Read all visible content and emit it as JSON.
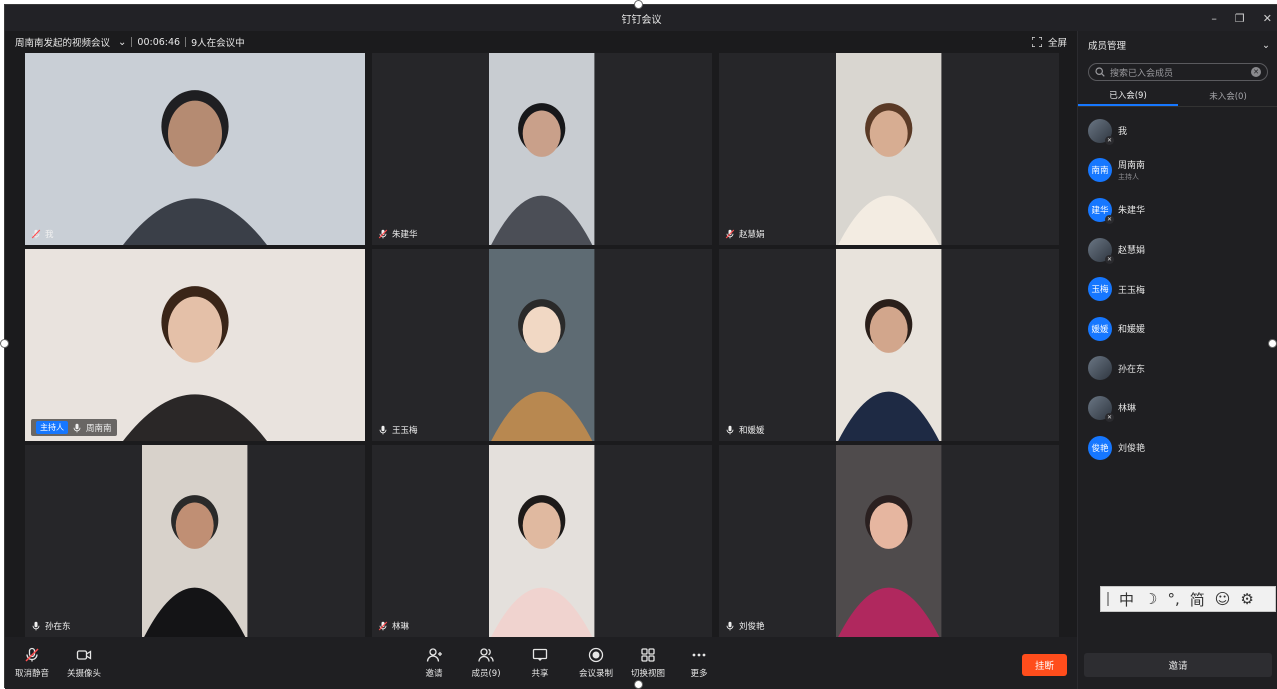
{
  "window": {
    "title": "钉钉会议",
    "controls": [
      "–",
      "❐",
      "✕"
    ]
  },
  "infobar": {
    "meeting_name": "周南南发起的视频会议",
    "duration": "00:06:46",
    "count_text": "9人在会议中",
    "fullscreen_label": "全屏"
  },
  "tiles": [
    {
      "name": "我",
      "mic": "muted",
      "host": false,
      "active": false,
      "bg": "#c9cfd6",
      "shirt": "#3a3f48",
      "skin": "#b58b72",
      "hair": "#1f1f22",
      "video_width_pct": 100
    },
    {
      "name": "朱建华",
      "mic": "muted",
      "host": false,
      "active": false,
      "bg": "#c8ccd1",
      "shirt": "#4b4e56",
      "skin": "#c9a08a",
      "hair": "#17171a",
      "video_width_pct": 31
    },
    {
      "name": "赵慧娟",
      "mic": "muted",
      "host": false,
      "active": false,
      "bg": "#d9d6d0",
      "shirt": "#f3ece2",
      "skin": "#d7ad92",
      "hair": "#5a3a26",
      "video_width_pct": 31
    },
    {
      "name": "周南南",
      "mic": "on",
      "host": true,
      "host_label": "主持人",
      "active": true,
      "bg": "#e9e3de",
      "shirt": "#2a2727",
      "skin": "#e4c0a8",
      "hair": "#3a2518",
      "video_width_pct": 100
    },
    {
      "name": "王玉梅",
      "mic": "on",
      "host": false,
      "active": false,
      "bg": "#5e6b73",
      "shirt": "#b88850",
      "skin": "#f1d8c4",
      "hair": "#2a2a2a",
      "video_width_pct": 31
    },
    {
      "name": "和媛媛",
      "mic": "on",
      "host": false,
      "active": false,
      "bg": "#e8e3dc",
      "shirt": "#1e2a44",
      "skin": "#d2a68c",
      "hair": "#2a1f1a",
      "video_width_pct": 31
    },
    {
      "name": "孙在东",
      "mic": "on",
      "host": false,
      "active": false,
      "bg": "#d8d2cb",
      "shirt": "#141416",
      "skin": "#c08f74",
      "hair": "#2a2a2a",
      "video_width_pct": 31
    },
    {
      "name": "林琳",
      "mic": "muted",
      "host": false,
      "active": false,
      "bg": "#e4e0dc",
      "shirt": "#f0d3cf",
      "skin": "#e0b9a0",
      "hair": "#1d1a19",
      "video_width_pct": 31
    },
    {
      "name": "刘俊艳",
      "mic": "on",
      "host": false,
      "active": false,
      "bg": "#4f4b4c",
      "shirt": "#b0285e",
      "skin": "#e6b6a0",
      "hair": "#2a2020",
      "video_width_pct": 31
    }
  ],
  "toolbar": {
    "unmute_label": "取消静音",
    "camera_off_label": "关摄像头",
    "invite_label": "邀请",
    "members_label": "成员(9)",
    "share_label": "共享",
    "record_label": "会议录制",
    "switch_view_label": "切换视图",
    "more_label": "更多",
    "hangup_label": "挂断"
  },
  "sidebar": {
    "title": "成员管理",
    "search_placeholder": "搜索已入会成员",
    "tab_joined": "已入会(9)",
    "tab_not_joined": "未入会(0)",
    "members": [
      {
        "name": "我",
        "avatar_text": "",
        "photo": true,
        "muted": true,
        "sub": ""
      },
      {
        "name": "周南南",
        "avatar_text": "南南",
        "photo": false,
        "muted": false,
        "sub": "主持人"
      },
      {
        "name": "朱建华",
        "avatar_text": "建华",
        "photo": false,
        "muted": true,
        "sub": ""
      },
      {
        "name": "赵慧娟",
        "avatar_text": "",
        "photo": true,
        "muted": true,
        "sub": ""
      },
      {
        "name": "王玉梅",
        "avatar_text": "玉梅",
        "photo": false,
        "muted": false,
        "sub": ""
      },
      {
        "name": "和媛媛",
        "avatar_text": "媛媛",
        "photo": false,
        "muted": false,
        "sub": ""
      },
      {
        "name": "孙在东",
        "avatar_text": "",
        "photo": true,
        "muted": false,
        "sub": ""
      },
      {
        "name": "林琳",
        "avatar_text": "",
        "photo": true,
        "muted": true,
        "sub": ""
      },
      {
        "name": "刘俊艳",
        "avatar_text": "俊艳",
        "photo": false,
        "muted": false,
        "sub": ""
      }
    ],
    "invite_label": "邀请"
  },
  "ime": {
    "items": [
      "中",
      "☽",
      "°,",
      "简",
      "☺",
      "⚙"
    ]
  }
}
